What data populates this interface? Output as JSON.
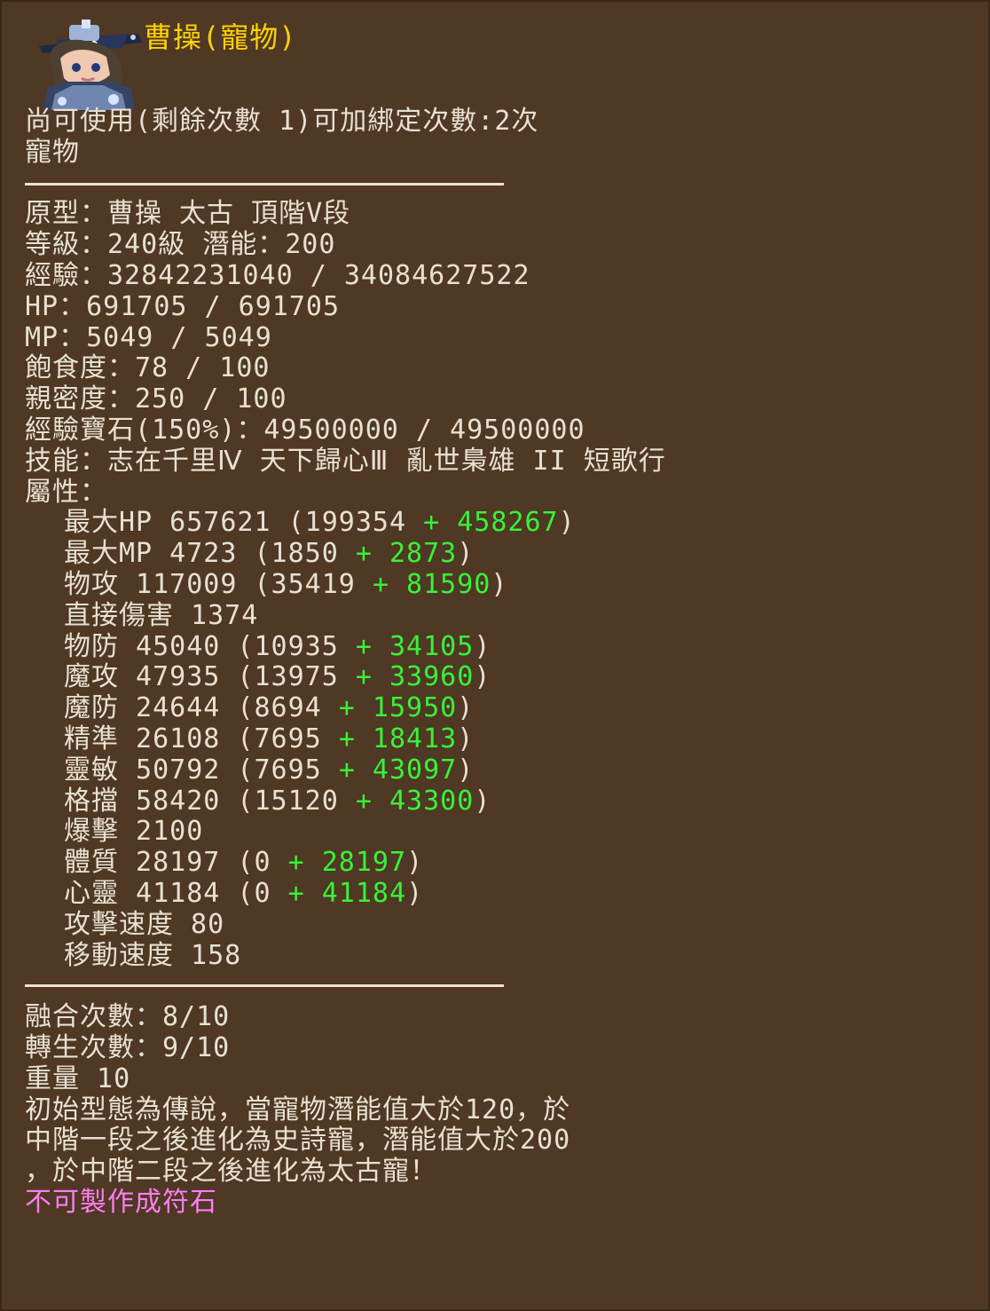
{
  "header": {
    "pet_name": "曹操(寵物)",
    "portrait_icon": "pet-portrait-icon"
  },
  "status": {
    "usage": "尚可使用(剩餘次數 1)可加綁定次數:2次",
    "type": "寵物"
  },
  "basic": {
    "prototype": "原型：曹操 太古 頂階V段",
    "level_potential": "等級：240級 潛能：200",
    "experience": "經驗：32842231040 / 34084627522",
    "hp": "HP：691705 / 691705",
    "mp": "MP：5049 / 5049",
    "satiety": "飽食度：78 / 100",
    "intimacy": "親密度：250 / 100",
    "exp_gem": "經驗寶石(150%)：49500000 / 49500000",
    "skills": "技能：志在千里Ⅳ 天下歸心Ⅲ 亂世梟雄 II 短歌行",
    "attributes_heading": "屬性："
  },
  "attributes": [
    {
      "label": "最大HP 657621 (199354 ",
      "bonus": "+ 458267",
      "close": ")"
    },
    {
      "label": "最大MP 4723 (1850 ",
      "bonus": "+ 2873",
      "close": ")"
    },
    {
      "label": "物攻 117009 (35419 ",
      "bonus": "+ 81590",
      "close": ")"
    },
    {
      "label": "直接傷害 1374",
      "bonus": "",
      "close": ""
    },
    {
      "label": "物防 45040 (10935 ",
      "bonus": "+ 34105",
      "close": ")"
    },
    {
      "label": "魔攻 47935 (13975 ",
      "bonus": "+ 33960",
      "close": ")"
    },
    {
      "label": "魔防 24644 (8694 ",
      "bonus": "+ 15950",
      "close": ")"
    },
    {
      "label": "精準 26108 (7695 ",
      "bonus": "+ 18413",
      "close": ")"
    },
    {
      "label": "靈敏 50792 (7695 ",
      "bonus": "+ 43097",
      "close": ")"
    },
    {
      "label": "格擋 58420 (15120 ",
      "bonus": "+ 43300",
      "close": ")"
    },
    {
      "label": "爆擊 2100",
      "bonus": "",
      "close": ""
    },
    {
      "label": "體質 28197 (0 ",
      "bonus": "+ 28197",
      "close": ")"
    },
    {
      "label": "心靈 41184 (0 ",
      "bonus": "+ 41184",
      "close": ")"
    },
    {
      "label": "攻擊速度 80",
      "bonus": "",
      "close": ""
    },
    {
      "label": "移動速度 158",
      "bonus": "",
      "close": ""
    }
  ],
  "footer": {
    "fusion": "融合次數：8/10",
    "rebirth": "轉生次數：9/10",
    "weight": "重量 10",
    "desc_1": "初始型態為傳說，當寵物潛能值大於120，於",
    "desc_2": "中階一段之後進化為史詩寵，潛能值大於200",
    "desc_3": "，於中階二段之後進化為太古寵！",
    "rune_note": "不可製作成符石"
  },
  "colors": {
    "background": "#4f3824",
    "text": "#e8e1d2",
    "title": "#ffd200",
    "bonus": "#38f238",
    "warning": "#ff7ef0"
  }
}
